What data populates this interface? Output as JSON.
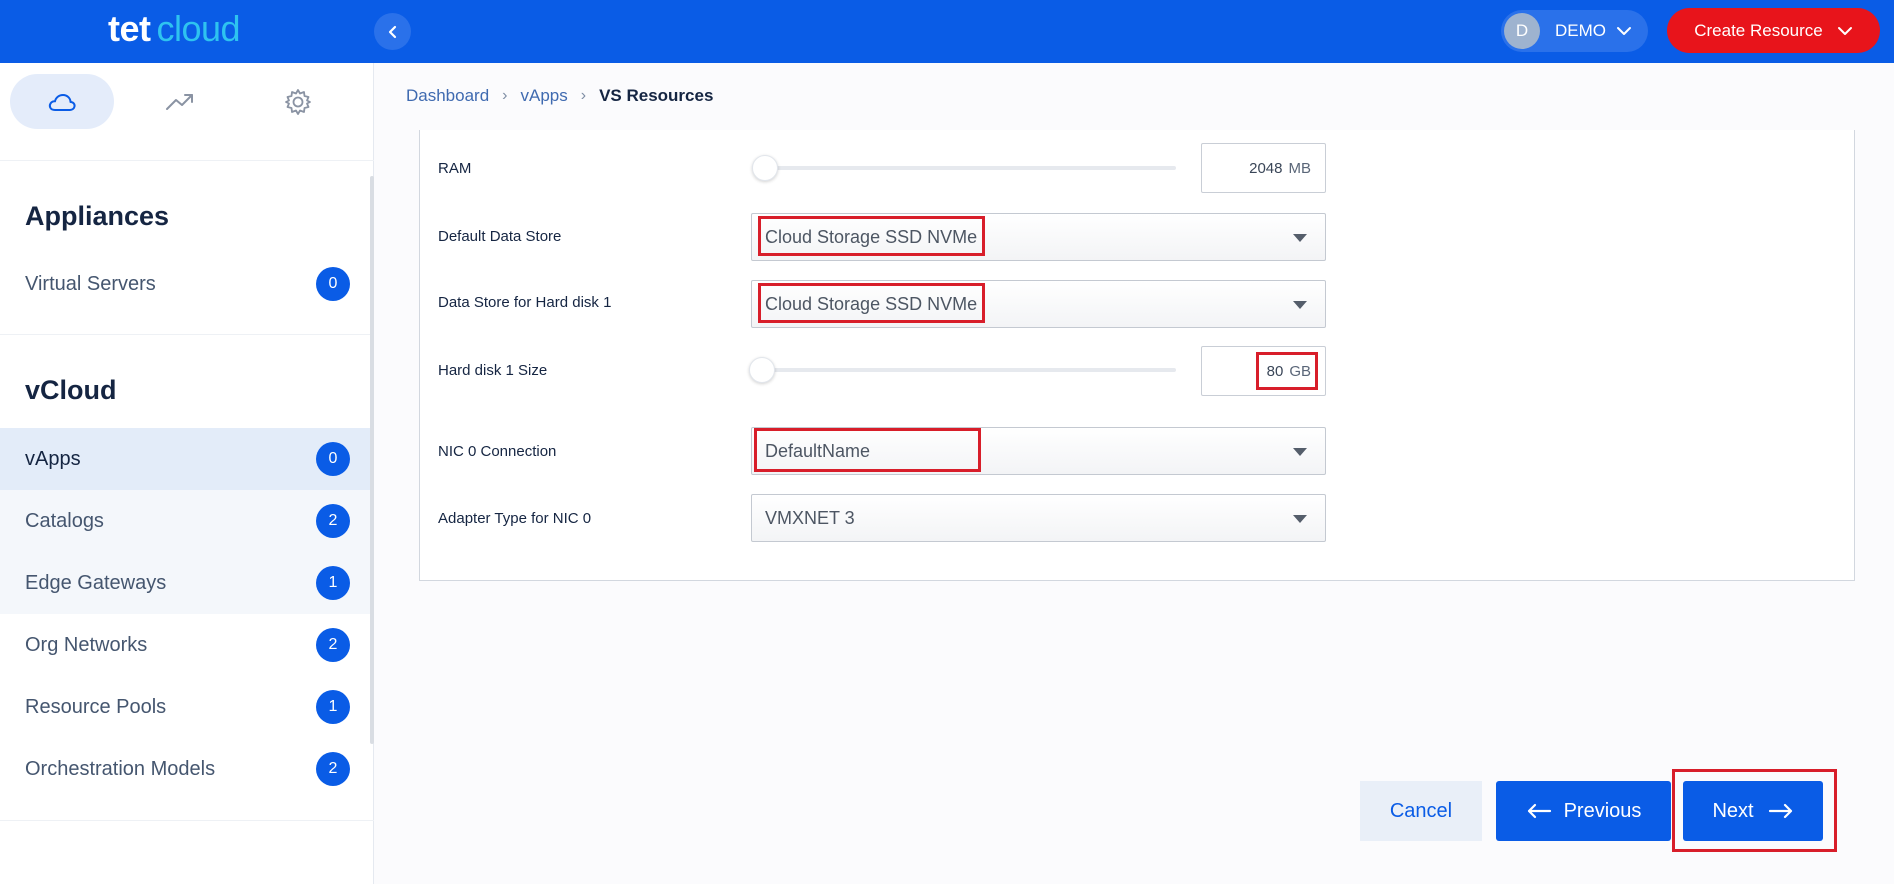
{
  "brand": {
    "logo_main": "tet",
    "logo_sub": "cloud"
  },
  "header": {
    "user_initial": "D",
    "user_name": "DEMO",
    "create_button": "Create Resource"
  },
  "sidebar": {
    "appliances_title": "Appliances",
    "appliances_items": [
      {
        "label": "Virtual Servers",
        "count": "0"
      }
    ],
    "vcloud_title": "vCloud",
    "vcloud_items": [
      {
        "label": "vApps",
        "count": "0"
      },
      {
        "label": "Catalogs",
        "count": "2"
      },
      {
        "label": "Edge Gateways",
        "count": "1"
      },
      {
        "label": "Org Networks",
        "count": "2"
      },
      {
        "label": "Resource Pools",
        "count": "1"
      },
      {
        "label": "Orchestration Models",
        "count": "2"
      }
    ]
  },
  "breadcrumb": {
    "items": [
      "Dashboard",
      "vApps"
    ],
    "current": "VS Resources"
  },
  "form": {
    "ram": {
      "label": "RAM",
      "value": "2048",
      "unit": "MB"
    },
    "default_data_store": {
      "label": "Default Data Store",
      "value": "Cloud Storage SSD NVMe"
    },
    "data_store_hd1": {
      "label": "Data Store for Hard disk 1",
      "value": "Cloud Storage SSD NVMe"
    },
    "hd1_size": {
      "label": "Hard disk 1 Size",
      "value": "80",
      "unit": "GB"
    },
    "nic0_connection": {
      "label": "NIC 0 Connection",
      "value": "DefaultName"
    },
    "nic0_adapter": {
      "label": "Adapter Type for NIC 0",
      "value": "VMXNET 3"
    }
  },
  "actions": {
    "cancel": "Cancel",
    "previous": "Previous",
    "next": "Next"
  },
  "colors": {
    "primary": "#0a5ce6",
    "danger": "#e8141b",
    "highlight": "#d81e2a"
  }
}
